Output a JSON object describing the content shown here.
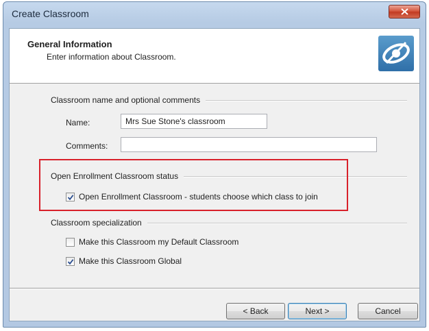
{
  "window": {
    "title": "Create Classroom"
  },
  "header": {
    "title": "General Information",
    "subtitle": "Enter information about Classroom."
  },
  "groups": {
    "name_comments": {
      "label": "Classroom name and optional comments",
      "name_label": "Name:",
      "name_value": "Mrs Sue Stone's classroom",
      "comments_label": "Comments:",
      "comments_value": ""
    },
    "open_enrollment": {
      "label": "Open Enrollment Classroom status",
      "checkbox_label": "Open Enrollment Classroom - students choose which class to join",
      "checked": true
    },
    "specialization": {
      "label": "Classroom specialization",
      "default_label": "Make this Classroom my Default Classroom",
      "default_checked": false,
      "global_label": "Make this Classroom Global",
      "global_checked": true
    }
  },
  "buttons": {
    "back": "< Back",
    "next": "Next >",
    "cancel": "Cancel"
  },
  "colors": {
    "highlight": "#d8202a",
    "logo": "#2f6fa8"
  }
}
